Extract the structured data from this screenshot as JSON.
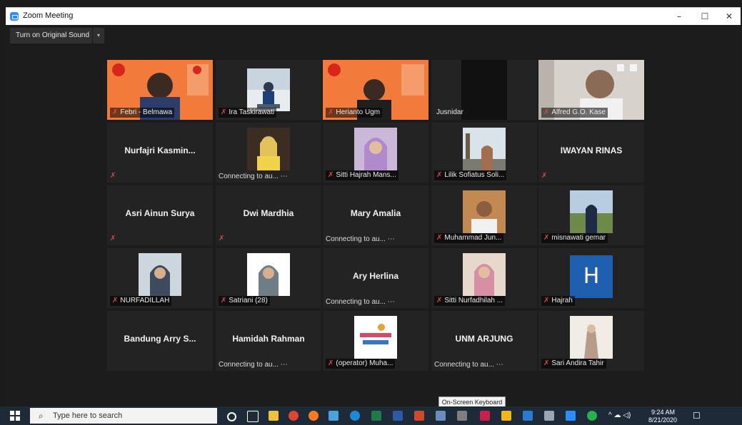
{
  "window": {
    "title": "Zoom Meeting",
    "minimize": "–",
    "maximize": "☐",
    "close": "✕"
  },
  "toolbar": {
    "original_sound": "Turn on Original Sound",
    "caret": "▾"
  },
  "tiles": [
    {
      "name": "Febri - Belmawa",
      "kind": "video"
    },
    {
      "name": "Ira Taskirawati",
      "kind": "video"
    },
    {
      "name": "Herianto Ugm",
      "kind": "video"
    },
    {
      "name": "Jusnidar",
      "kind": "video"
    },
    {
      "name": "Alfred G.O. Kase",
      "kind": "video"
    },
    {
      "name": "Nurfajri  Kasmin...",
      "kind": "text"
    },
    {
      "name": "Connecting to au... ⋯",
      "kind": "photo"
    },
    {
      "name": "Sitti Hajrah Mans...",
      "kind": "photo"
    },
    {
      "name": "Lilik Sofiatus Soli...",
      "kind": "photo"
    },
    {
      "name": "IWAYAN RINAS",
      "kind": "text"
    },
    {
      "name": "Asri Ainun Surya",
      "kind": "text"
    },
    {
      "name": "Dwi Mardhia",
      "kind": "text"
    },
    {
      "name": "Mary Amalia",
      "kind": "text",
      "status": "Connecting to au... ⋯"
    },
    {
      "name": "Muhammad Jun...",
      "kind": "photo"
    },
    {
      "name": "misnawati gemar",
      "kind": "photo"
    },
    {
      "name": "NURFADILLAH",
      "kind": "photo"
    },
    {
      "name": "Satriani (28)",
      "kind": "photo"
    },
    {
      "name": "Ary Herlina",
      "kind": "text",
      "status": "Connecting to au... ⋯"
    },
    {
      "name": "Sitti Nurfadhilah ...",
      "kind": "photo"
    },
    {
      "name": "Hajrah",
      "kind": "letter",
      "letter": "H"
    },
    {
      "name": "Bandung Arry S...",
      "kind": "text"
    },
    {
      "name": "Hamidah Rahman",
      "kind": "text",
      "status": "Connecting to au... ⋯"
    },
    {
      "name": "(operator) Muha...",
      "kind": "photo"
    },
    {
      "name": "UNM ARJUNG",
      "kind": "text",
      "status": "Connecting to au... ⋯"
    },
    {
      "name": "Sari Andira Tahir",
      "kind": "photo"
    }
  ],
  "taskbar": {
    "search_placeholder": "Type here to search",
    "tooltip": "On-Screen Keyboard",
    "time": "9:24 AM",
    "date": "8/21/2020"
  },
  "colors": {
    "active_border": "#b9d75a",
    "muted_mic": "#e04444",
    "letter_tile": "#1e5fb0"
  }
}
